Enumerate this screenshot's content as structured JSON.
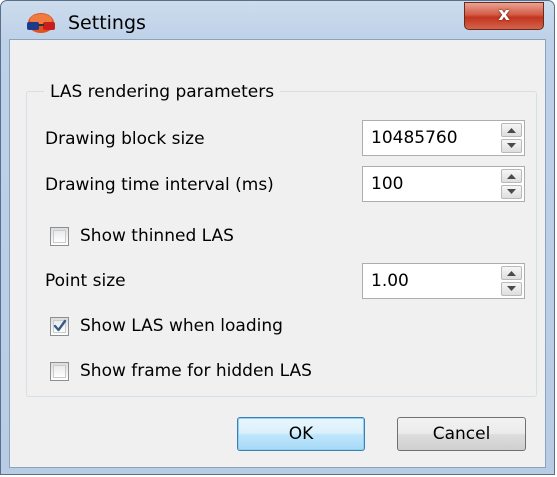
{
  "window": {
    "title": "Settings",
    "close_label": "x"
  },
  "group": {
    "title": "LAS rendering parameters"
  },
  "fields": {
    "block_size": {
      "label": "Drawing block size",
      "value": "10485760"
    },
    "time_interval": {
      "label": "Drawing time interval (ms)",
      "value": "100"
    },
    "point_size": {
      "label": "Point size",
      "value": "1.00"
    }
  },
  "checkboxes": {
    "show_thinned": {
      "label": "Show thinned LAS",
      "checked": false
    },
    "show_when_loading": {
      "label": "Show LAS when loading",
      "checked": true
    },
    "show_frame_hidden": {
      "label": "Show frame for hidden LAS",
      "checked": false
    }
  },
  "buttons": {
    "ok_label": "OK",
    "cancel_label": "Cancel"
  },
  "icons": {
    "app": "las-3d-glasses-icon",
    "close": "close-icon",
    "spin_up": "chevron-up-icon",
    "spin_down": "chevron-down-icon",
    "check": "checkmark-icon"
  },
  "colors": {
    "close_button": "#c2361f",
    "ok_accent": "#3c7fb1",
    "checkmark": "#3a5a8a"
  }
}
